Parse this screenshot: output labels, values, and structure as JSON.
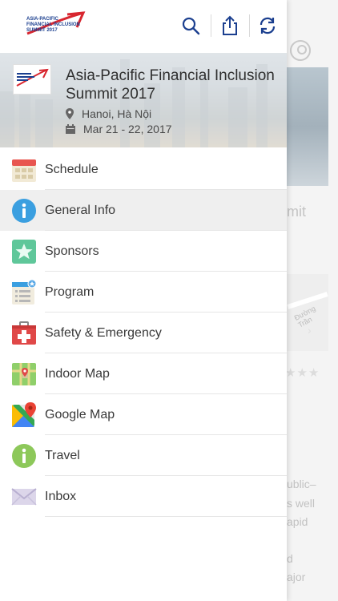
{
  "background": {
    "title_fragment": "mit",
    "map_label": "Đường Trần",
    "description_lines": [
      "ublic–",
      "s well",
      "apid",
      "d",
      "ajor"
    ]
  },
  "topbar": {
    "logo_text_line1": "ASIA-PACIFIC",
    "logo_text_line2": "FINANCIAL INCLUSION",
    "logo_text_line3": "SUMMIT 2017",
    "icons": [
      "search-icon",
      "share-icon",
      "refresh-icon"
    ]
  },
  "event": {
    "title": "Asia-Pacific Financial Inclusion Summit 2017",
    "location": "Hanoi, Hà Nội",
    "dates": "Mar 21 - 22, 2017"
  },
  "menu": {
    "active_index": 1,
    "items": [
      {
        "label": "Schedule",
        "icon": "calendar-icon"
      },
      {
        "label": "General Info",
        "icon": "info-icon"
      },
      {
        "label": "Sponsors",
        "icon": "star-icon"
      },
      {
        "label": "Program",
        "icon": "program-list-icon"
      },
      {
        "label": "Safety & Emergency",
        "icon": "first-aid-kit-icon"
      },
      {
        "label": "Indoor Map",
        "icon": "indoor-map-icon"
      },
      {
        "label": "Google Map",
        "icon": "google-map-icon"
      },
      {
        "label": "Travel",
        "icon": "travel-info-icon"
      },
      {
        "label": "Inbox",
        "icon": "envelope-icon"
      }
    ]
  },
  "colors": {
    "accent_blue": "#1b3f8f",
    "accent_red": "#d8262f",
    "info_blue": "#3b9fe0",
    "sponsor_green": "#5fc79a",
    "travel_green": "#8dc85a"
  }
}
